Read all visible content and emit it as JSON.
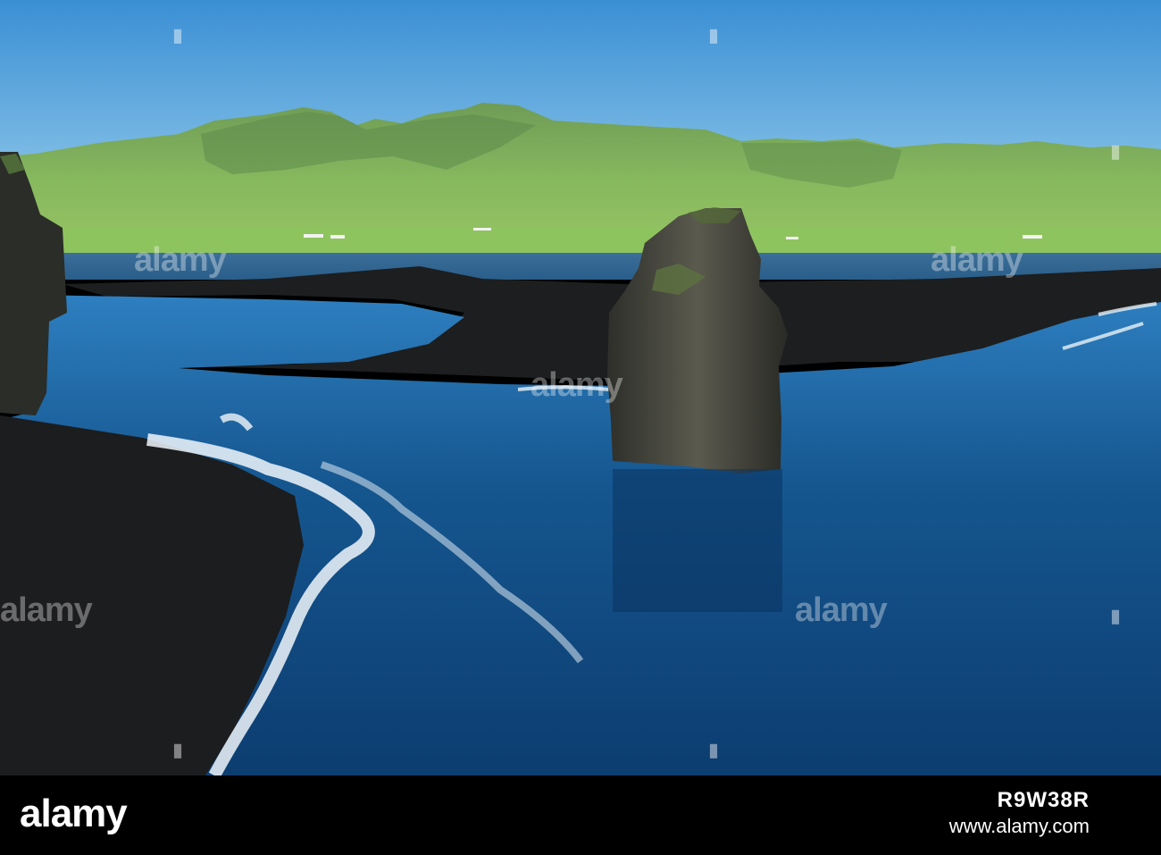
{
  "watermark": {
    "brand": "alamy",
    "image_id": "R9W38R",
    "url": "www.alamy.com"
  },
  "colors": {
    "sky_top": "#3f93d6",
    "sky_bottom": "#a9d6ef",
    "ocean": "#114a86",
    "sand": "#1a1b1d",
    "hills": "#7fa95a",
    "rock": "#3a3a32"
  }
}
